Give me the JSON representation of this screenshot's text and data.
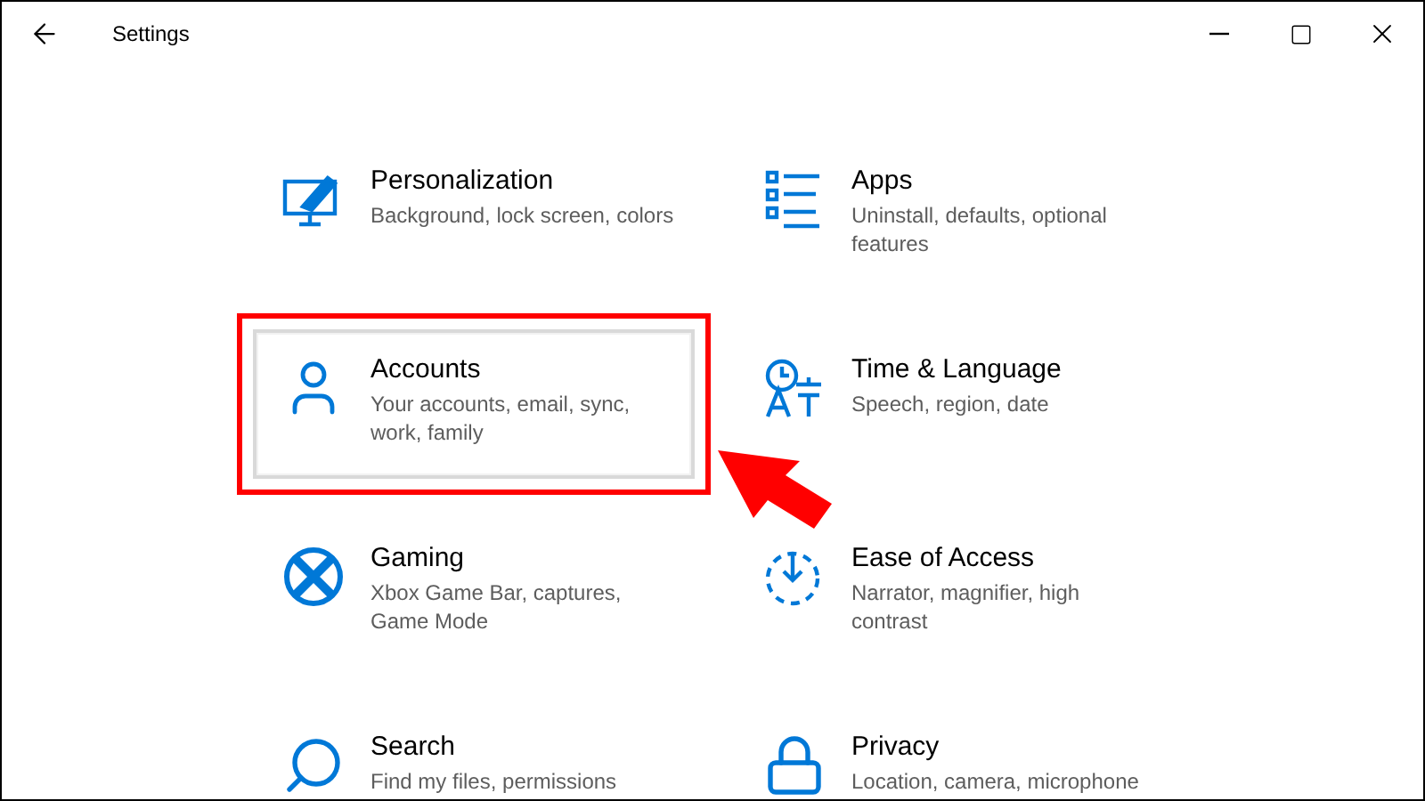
{
  "window": {
    "title": "Settings"
  },
  "categories": [
    {
      "title": "Personalization",
      "description": "Background, lock screen, colors",
      "selected": false,
      "annotated": false
    },
    {
      "title": "Apps",
      "description": "Uninstall, defaults, optional features",
      "selected": false,
      "annotated": false
    },
    {
      "title": "Accounts",
      "description": "Your accounts, email, sync, work, family",
      "selected": true,
      "annotated": true
    },
    {
      "title": "Time & Language",
      "description": "Speech, region, date",
      "selected": false,
      "annotated": false
    },
    {
      "title": "Gaming",
      "description": "Xbox Game Bar, captures, Game Mode",
      "selected": false,
      "annotated": false
    },
    {
      "title": "Ease of Access",
      "description": "Narrator, magnifier, high contrast",
      "selected": false,
      "annotated": false
    },
    {
      "title": "Search",
      "description": "Find my files, permissions",
      "selected": false,
      "annotated": false
    },
    {
      "title": "Privacy",
      "description": "Location, camera, microphone",
      "selected": false,
      "annotated": false
    }
  ]
}
